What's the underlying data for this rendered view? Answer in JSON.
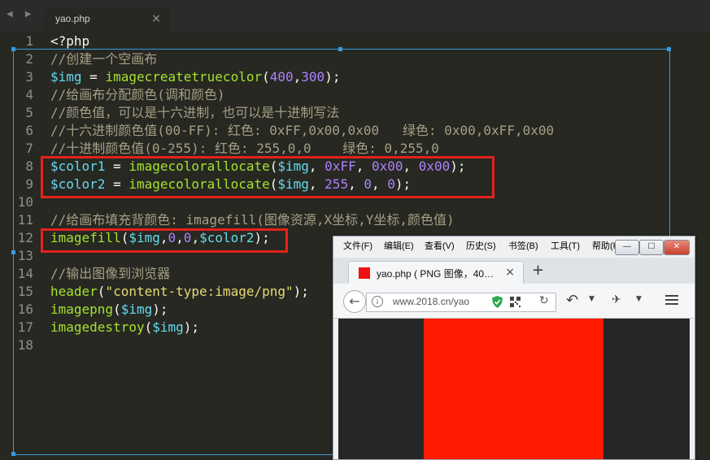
{
  "editor": {
    "tab_title": "yao.php",
    "tab_close": "×",
    "nav_arrows": "◀ ▶",
    "line_numbers": [
      "1",
      "2",
      "3",
      "4",
      "5",
      "6",
      "7",
      "8",
      "9",
      "10",
      "11",
      "12",
      "13",
      "14",
      "15",
      "16",
      "17",
      "18"
    ],
    "lines": [
      [
        [
          "plain",
          "<?php"
        ]
      ],
      [
        [
          "comment",
          "//创建一个空画布"
        ]
      ],
      [
        [
          "var",
          "$img"
        ],
        [
          "plain",
          " = "
        ],
        [
          "fn",
          "imagecreatetruecolor"
        ],
        [
          "plain",
          "("
        ],
        [
          "num",
          "400"
        ],
        [
          "plain",
          ","
        ],
        [
          "num",
          "300"
        ],
        [
          "plain",
          ");"
        ]
      ],
      [
        [
          "comment",
          "//给画布分配颜色(调和颜色)"
        ]
      ],
      [
        [
          "comment",
          "//颜色值，可以是十六进制，也可以是十进制写法"
        ]
      ],
      [
        [
          "comment",
          "//十六进制颜色值(00-FF): 红色: 0xFF,0x00,0x00   绿色: 0x00,0xFF,0x00"
        ]
      ],
      [
        [
          "comment",
          "//十进制颜色值(0-255): 红色: 255,0,0    绿色: 0,255,0"
        ]
      ],
      [
        [
          "var",
          "$color1"
        ],
        [
          "plain",
          " = "
        ],
        [
          "fn",
          "imagecolorallocate"
        ],
        [
          "plain",
          "("
        ],
        [
          "var",
          "$img"
        ],
        [
          "plain",
          ", "
        ],
        [
          "num",
          "0xFF"
        ],
        [
          "plain",
          ", "
        ],
        [
          "num",
          "0x00"
        ],
        [
          "plain",
          ", "
        ],
        [
          "num",
          "0x00"
        ],
        [
          "plain",
          ");"
        ]
      ],
      [
        [
          "var",
          "$color2"
        ],
        [
          "plain",
          " = "
        ],
        [
          "fn",
          "imagecolorallocate"
        ],
        [
          "plain",
          "("
        ],
        [
          "var",
          "$img"
        ],
        [
          "plain",
          ", "
        ],
        [
          "num",
          "255"
        ],
        [
          "plain",
          ", "
        ],
        [
          "num",
          "0"
        ],
        [
          "plain",
          ", "
        ],
        [
          "num",
          "0"
        ],
        [
          "plain",
          ");"
        ]
      ],
      [],
      [
        [
          "comment",
          "//给画布填充背颜色: imagefill(图像资源,X坐标,Y坐标,颜色值)"
        ]
      ],
      [
        [
          "fn",
          "imagefill"
        ],
        [
          "plain",
          "("
        ],
        [
          "var",
          "$img"
        ],
        [
          "plain",
          ","
        ],
        [
          "num",
          "0"
        ],
        [
          "plain",
          ","
        ],
        [
          "num",
          "0"
        ],
        [
          "plain",
          ","
        ],
        [
          "var",
          "$color2"
        ],
        [
          "plain",
          ");"
        ]
      ],
      [],
      [
        [
          "comment",
          "//输出图像到浏览器"
        ]
      ],
      [
        [
          "fn",
          "header"
        ],
        [
          "plain",
          "("
        ],
        [
          "str",
          "\"content-type:image/png\""
        ],
        [
          "plain",
          ");"
        ]
      ],
      [
        [
          "fn",
          "imagepng"
        ],
        [
          "plain",
          "("
        ],
        [
          "var",
          "$img"
        ],
        [
          "plain",
          ");"
        ]
      ],
      [
        [
          "fn",
          "imagedestroy"
        ],
        [
          "plain",
          "("
        ],
        [
          "var",
          "$img"
        ],
        [
          "plain",
          ");"
        ]
      ],
      []
    ]
  },
  "browser": {
    "menu": [
      "文件(F)",
      "编辑(E)",
      "查看(V)",
      "历史(S)",
      "书签(B)",
      "工具(T)",
      "帮助(H)"
    ],
    "window_buttons": {
      "minimize": "—",
      "maximize": "☐",
      "close": "✕"
    },
    "tab_title": "yao.php ( PNG 图像，40…",
    "tab_close": "×",
    "new_tab": "+",
    "url": "www.2018.cn/yao",
    "image_color": "#ff1a00",
    "page_background": "#262626"
  },
  "colors": {
    "editor_bg": "#272822",
    "highlight_box": "#e3221b",
    "selection_frame": "#3a9bdc"
  }
}
